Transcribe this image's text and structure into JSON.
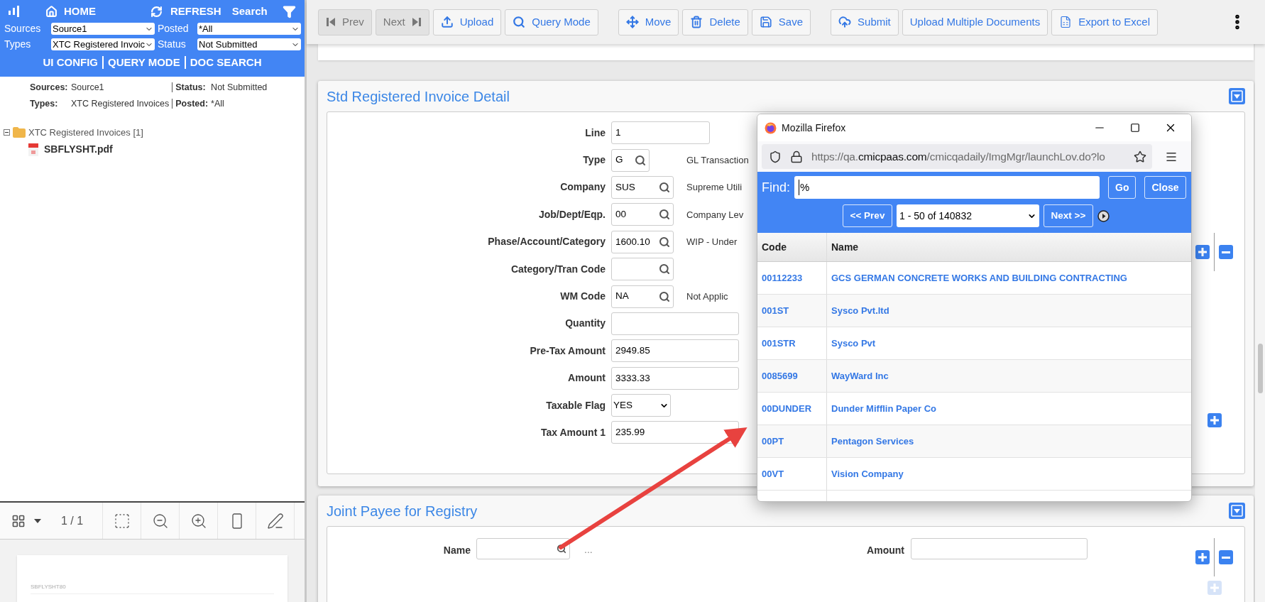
{
  "sidebar": {
    "header": {
      "home": "HOME",
      "refresh": "REFRESH",
      "search": "Search"
    },
    "filters": [
      {
        "label": "Sources",
        "value": "Source1"
      },
      {
        "label": "Posted",
        "value": "*All"
      },
      {
        "label": "Types",
        "value": "XTC Registered Invoic"
      },
      {
        "label": "Status",
        "value": "Not Submitted"
      }
    ],
    "links": [
      "UI CONFIG",
      "QUERY MODE",
      "DOC SEARCH"
    ],
    "summary": [
      {
        "label": "Sources:",
        "value": "Source1"
      },
      {
        "label": "Status:",
        "value": "Not Submitted"
      },
      {
        "label": "Types:",
        "value": "XTC Registered Invoices"
      },
      {
        "label": "Posted:",
        "value": "*All"
      }
    ],
    "tree": [
      {
        "label": "XTC Registered Invoices [1]",
        "expanded": true,
        "children": [
          {
            "label": "SBFLYSHT.pdf"
          }
        ]
      }
    ]
  },
  "viewer": {
    "page": "1 / 1",
    "preview": {
      "title": "SBFLYSHT80"
    }
  },
  "toolbar": {
    "groups": [
      [
        {
          "label": "Prev",
          "disabled": true
        },
        {
          "label": "Next",
          "disabled": true
        },
        {
          "label": "Upload",
          "disabled": false
        },
        {
          "label": "Query Mode",
          "disabled": false
        }
      ],
      [
        {
          "label": "Move",
          "disabled": false
        },
        {
          "label": "Delete",
          "disabled": false
        },
        {
          "label": "Save",
          "disabled": false
        }
      ],
      [
        {
          "label": "Submit",
          "disabled": false
        },
        {
          "label": "Upload Multiple Documents",
          "disabled": false
        },
        {
          "label": "Export to Excel",
          "disabled": false
        }
      ]
    ]
  },
  "detail": {
    "title": "Std Registered Invoice Detail",
    "expanded": true,
    "fields": [
      {
        "label": "Line",
        "kind": "short-text",
        "value": "1"
      },
      {
        "label": "Type",
        "kind": "short-lookup",
        "value": "G",
        "description": "GL Transaction"
      },
      {
        "label": "Company",
        "kind": "lookup",
        "value": "SUS",
        "description": "Supreme Utili"
      },
      {
        "label": "Job/Dept/Eqp.",
        "kind": "lookup",
        "value": "00",
        "description": "Company Lev"
      },
      {
        "label": "Phase/Account/Category",
        "kind": "lookup",
        "value": "1600.10",
        "description": "WIP - Under"
      },
      {
        "label": "Category/Tran Code",
        "kind": "lookup"
      },
      {
        "label": "WM Code",
        "kind": "lookup",
        "value": "NA",
        "description": "Not Applic"
      },
      {
        "label": "Quantity",
        "kind": "text"
      },
      {
        "label": "Pre-Tax Amount",
        "kind": "text",
        "value": "2949.85"
      },
      {
        "label": "Amount",
        "kind": "text",
        "value": "3333.33"
      },
      {
        "label": "Taxable Flag",
        "kind": "select",
        "value": "YES"
      },
      {
        "label": "Tax Amount 1",
        "kind": "text",
        "value": "235.99"
      }
    ]
  },
  "joint_payee": {
    "title": "Joint Payee for Registry",
    "expanded": true,
    "name_label": "Name",
    "more": "...",
    "amount_label": "Amount"
  },
  "popup": {
    "title": "Mozilla Firefox",
    "url_prefix": "https://qa.",
    "url_domain": "cmicpaas.com",
    "url_path": "/cmicqadaily/ImgMgr/launchLov.do?lo",
    "find_label": "Find:",
    "find_value": "%",
    "go": "Go",
    "close": "Close",
    "prev": "<< Prev",
    "range": "1 - 50 of 140832",
    "next": "Next >>",
    "columns": [
      "Code",
      "Name"
    ],
    "rows": [
      {
        "code": "00112233",
        "name": "GCS GERMAN CONCRETE WORKS AND BUILDING CONTRACTING"
      },
      {
        "code": "001ST",
        "name": "Sysco Pvt.ltd"
      },
      {
        "code": "001STR",
        "name": "Sysco Pvt"
      },
      {
        "code": "0085699",
        "name": "WayWard Inc"
      },
      {
        "code": "00DUNDER",
        "name": "Dunder Mifflin Paper Co"
      },
      {
        "code": "00PT",
        "name": "Pentagon Services"
      },
      {
        "code": "00VT",
        "name": "Vision Company"
      }
    ]
  }
}
